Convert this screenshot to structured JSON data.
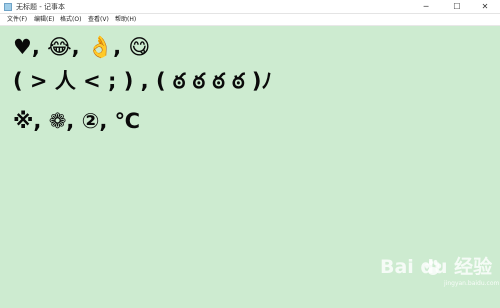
{
  "window": {
    "title": "无标题 - 记事本",
    "controls": {
      "minimize": "─",
      "maximize": "☐",
      "close": "✕"
    }
  },
  "menu": {
    "items": [
      {
        "label": "文件(F)"
      },
      {
        "label": "编辑(E)"
      },
      {
        "label": "格式(O)"
      },
      {
        "label": "查看(V)"
      },
      {
        "label": "帮助(H)"
      }
    ]
  },
  "editor": {
    "lines": [
      "♥, 😂, 👌, 😋",
      " ( > 人 < ; ) , ( ఠ ఠ ఠ ఠ )ﾉ",
      "※, ❁, ②, ℃"
    ]
  },
  "watermark": {
    "text": "Bai du 经验",
    "sub": "jingyan.baidu.com"
  }
}
